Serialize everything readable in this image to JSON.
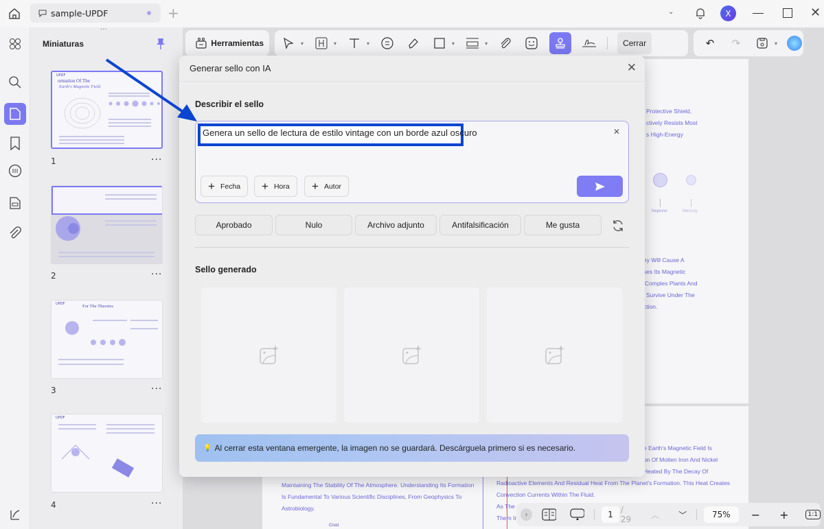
{
  "window": {
    "tab_title": "sample-UPDF",
    "avatar_letter": "X"
  },
  "sidebar": {
    "title": "Miniaturas",
    "thumbnails": [
      {
        "number": "1",
        "more": "···"
      },
      {
        "number": "2",
        "more": "···"
      },
      {
        "number": "3",
        "more": "···"
      },
      {
        "number": "4",
        "more": "···"
      }
    ],
    "thumb_titles": [
      "ormation Of The",
      "Earth's Magnetic Field",
      "For The Theories"
    ]
  },
  "toolbar": {
    "tools_label": "Herramientas",
    "close_label": "Cerrar"
  },
  "document": {
    "right_lines": [
      "Protective Shield,",
      "ctively Resists Most",
      "s High-Energy",
      "ey Will Cause A",
      "ses Its Magnetic",
      "Complex Plants And",
      "Survive Under The",
      "ction."
    ],
    "planet_labels": [
      "Neptune",
      "Mercury"
    ],
    "lower_right_lines": [
      "e Earth's Magnetic Field Is",
      "on Of Molten Iron And Nickel",
      "Heated By The Decay Of",
      "Radioactive Elements And Residual Heat From The Planet's Formation. This Heat Creates",
      "Convection Currents Within The Fluid.",
      "As The",
      "Them In"
    ],
    "lower_left_lines": [
      "Maintaining The Stability Of The Atmosphere. Understanding Its Formation",
      "Is Fundamental To Various Scientific Disciplines, From Geophysics To",
      "Astrobiology."
    ],
    "crust_label": "Crust"
  },
  "modal": {
    "title": "Generar sello con IA",
    "describe_label": "Describir el sello",
    "prompt_value": "Genera un sello de lectura de estilo vintage con un borde azul oscuro",
    "chips": [
      "Fecha",
      "Hora",
      "Autor"
    ],
    "presets": [
      "Aprobado",
      "Nulo",
      "Archivo adjunto",
      "Antifalsificación",
      "Me gusta"
    ],
    "generated_label": "Sello generado",
    "notice": "Al cerrar esta ventana emergente, la imagen no se guardará. Descárguela primero si es necesario."
  },
  "pager": {
    "current_page": "1",
    "total": "/ 29",
    "zoom": "75%",
    "fit_label": "1:1"
  },
  "colors": {
    "accent": "#7b79f2",
    "annotation_arrow": "#0a45d0",
    "highlight_border": "#0a45d0"
  }
}
